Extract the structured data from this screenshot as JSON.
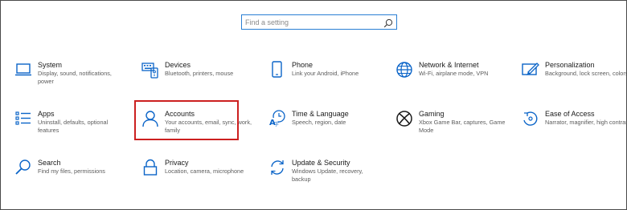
{
  "search": {
    "placeholder": "Find a setting"
  },
  "colors": {
    "accent": "#0a64c8",
    "highlight": "#cc2020"
  },
  "tiles": [
    {
      "title": "System",
      "desc": "Display, sound, notifications, power",
      "icon": "laptop-icon"
    },
    {
      "title": "Devices",
      "desc": "Bluetooth, printers, mouse",
      "icon": "keyboard-icon"
    },
    {
      "title": "Phone",
      "desc": "Link your Android, iPhone",
      "icon": "phone-icon"
    },
    {
      "title": "Network & Internet",
      "desc": "Wi-Fi, airplane mode, VPN",
      "icon": "globe-icon"
    },
    {
      "title": "Personalization",
      "desc": "Background, lock screen, colors",
      "icon": "paint-icon"
    },
    {
      "title": "Apps",
      "desc": "Uninstall, defaults, optional features",
      "icon": "apps-list-icon"
    },
    {
      "title": "Accounts",
      "desc": "Your accounts, email, sync, work, family",
      "icon": "person-icon"
    },
    {
      "title": "Time & Language",
      "desc": "Speech, region, date",
      "icon": "time-language-icon"
    },
    {
      "title": "Gaming",
      "desc": "Xbox Game Bar, captures, Game Mode",
      "icon": "xbox-icon"
    },
    {
      "title": "Ease of Access",
      "desc": "Narrator, magnifier, high contrast",
      "icon": "ease-of-access-icon"
    },
    {
      "title": "Search",
      "desc": "Find my files, permissions",
      "icon": "search-icon"
    },
    {
      "title": "Privacy",
      "desc": "Location, camera, microphone",
      "icon": "lock-icon"
    },
    {
      "title": "Update & Security",
      "desc": "Windows Update, recovery, backup",
      "icon": "update-icon"
    }
  ]
}
